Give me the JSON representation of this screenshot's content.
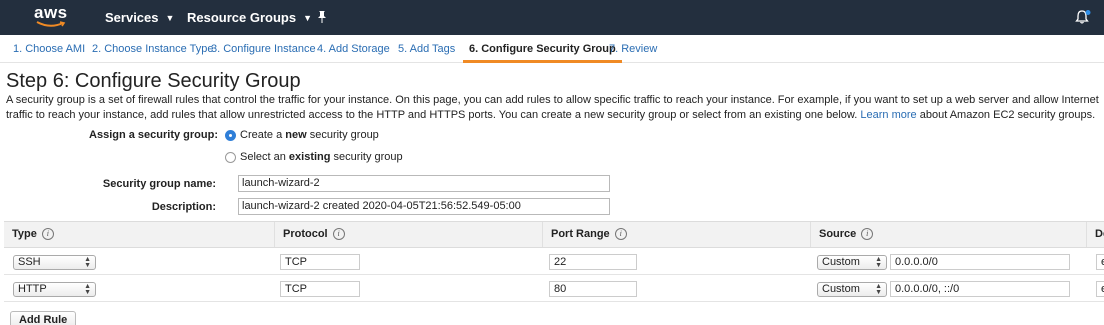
{
  "nav": {
    "logo_text": "aws",
    "services": "Services",
    "resource_groups": "Resource Groups",
    "colors": {
      "bar": "#232f3e",
      "logo_smile": "#f08a24"
    }
  },
  "wizard": {
    "tabs": [
      {
        "label": "1. Choose AMI"
      },
      {
        "label": "2. Choose Instance Type"
      },
      {
        "label": "3. Configure Instance"
      },
      {
        "label": "4. Add Storage"
      },
      {
        "label": "5. Add Tags"
      },
      {
        "label": "6. Configure Security Group",
        "active": true
      },
      {
        "label": "7. Review"
      }
    ]
  },
  "page": {
    "title": "Step 6: Configure Security Group",
    "description_1": "A security group is a set of firewall rules that control the traffic for your instance. On this page, you can add rules to allow specific traffic to reach your instance. For example, if you want to set up a web server and allow Internet traffic to reach your instance, add rules that allow unrestricted access to",
    "description_2": "the HTTP and HTTPS ports. You can create a new security group or select from an existing one below.",
    "learn_more": "Learn more",
    "description_3": "about Amazon EC2 security groups."
  },
  "form": {
    "assign_label": "Assign a security group:",
    "option_new": {
      "pre": "Create a ",
      "bold": "new",
      "post": " security group",
      "selected": true
    },
    "option_existing": {
      "pre": "Select an ",
      "bold": "existing",
      "post": " security group",
      "selected": false
    },
    "name_label": "Security group name:",
    "name_value": "launch-wizard-2",
    "desc_label": "Description:",
    "desc_value": "launch-wizard-2 created 2020-04-05T21:56:52.549-05:00"
  },
  "table": {
    "headers": {
      "type": "Type",
      "protocol": "Protocol",
      "port_range": "Port Range",
      "source": "Source",
      "description": "De"
    },
    "rows": [
      {
        "type": "SSH",
        "protocol": "TCP",
        "port_range": "22",
        "source_mode": "Custom",
        "source_value": "0.0.0.0/0",
        "description": "e"
      },
      {
        "type": "HTTP",
        "protocol": "TCP",
        "port_range": "80",
        "source_mode": "Custom",
        "source_value": "0.0.0.0/0, ::/0",
        "description": "e"
      }
    ]
  },
  "add_rule": "Add Rule"
}
